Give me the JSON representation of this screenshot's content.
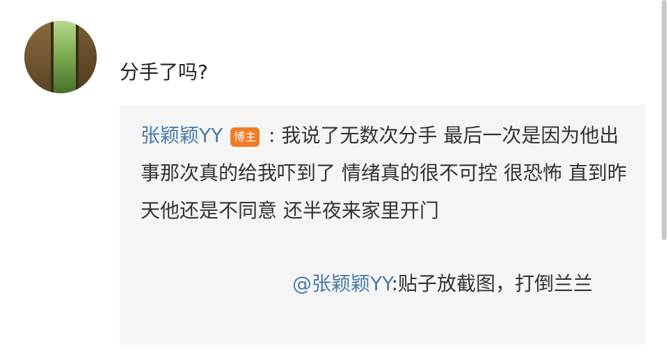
{
  "comment": {
    "avatar_icon": "garden-door-avatar-icon",
    "text": "分手了吗?"
  },
  "quote": {
    "username": "张颖颖YY",
    "badge": "博主",
    "text": ": 我说了无数次分手 最后一次是因为他出事那次真的给我吓到了 情绪真的很不可控 很恐怖 直到昨天他还是不同意 还半夜来家里开门"
  },
  "reply": {
    "mention": "@张颖颖YY",
    "text": ":贴子放截图，打倒兰兰"
  },
  "colors": {
    "link": "#4a7aa8",
    "badge": "#f17c28",
    "quote_bg": "#f5f5f5"
  }
}
